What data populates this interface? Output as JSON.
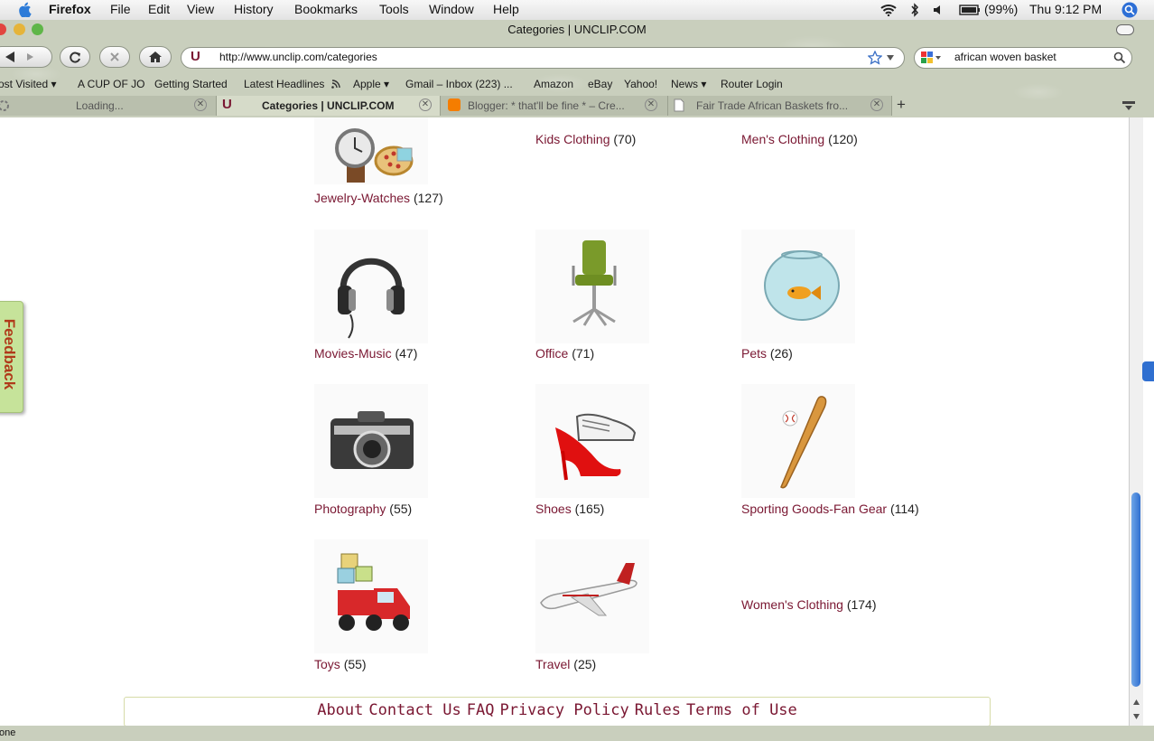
{
  "menubar": {
    "app_name": "Firefox",
    "items": [
      "File",
      "Edit",
      "View",
      "History",
      "Bookmarks",
      "Tools",
      "Window",
      "Help"
    ],
    "battery": "(99%)",
    "clock": "Thu 9:12 PM"
  },
  "window": {
    "title": "Categories | UNCLIP.COM"
  },
  "toolbar": {
    "url": "http://www.unclip.com/categories",
    "search_value": "african woven basket",
    "site_favicon_letter": "U"
  },
  "bookmarks": [
    "ost Visited ▾",
    "A CUP OF JO",
    "Getting Started",
    "Latest Headlines",
    "Apple ▾",
    "Gmail – Inbox (223) ...",
    "Amazon",
    "eBay",
    "Yahoo!",
    "News ▾",
    "Router Login"
  ],
  "tabs": [
    {
      "label": "Loading..."
    },
    {
      "label": "Categories | UNCLIP.COM"
    },
    {
      "label": "Blogger: * that'll be fine * – Cre..."
    },
    {
      "label": "Fair Trade African Baskets fro..."
    }
  ],
  "categories": [
    {
      "name": "Jewelry-Watches",
      "count": "(127)"
    },
    {
      "name": "Kids Clothing",
      "count": "(70)"
    },
    {
      "name": "Men's Clothing",
      "count": "(120)"
    },
    {
      "name": "Movies-Music",
      "count": "(47)"
    },
    {
      "name": "Office",
      "count": "(71)"
    },
    {
      "name": "Pets",
      "count": "(26)"
    },
    {
      "name": "Photography",
      "count": "(55)"
    },
    {
      "name": "Shoes",
      "count": "(165)"
    },
    {
      "name": "Sporting Goods-Fan Gear",
      "count": "(114)"
    },
    {
      "name": "Toys",
      "count": "(55)"
    },
    {
      "name": "Travel",
      "count": "(25)"
    },
    {
      "name": "Women's Clothing",
      "count": "(174)"
    }
  ],
  "footer": {
    "links": [
      "About",
      "Contact Us",
      "FAQ",
      "Privacy Policy",
      "Rules",
      "Terms of Use"
    ]
  },
  "feedback_tab": "Feedback",
  "status": "one"
}
